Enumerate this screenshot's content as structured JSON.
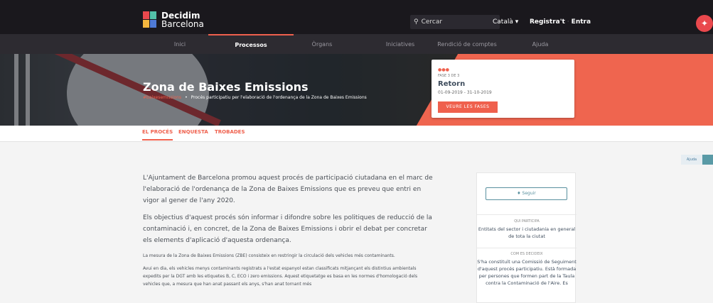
{
  "header": {
    "logo_line1": "Decidim",
    "logo_line2": "Barcelona",
    "search_placeholder": "Cercar",
    "language": "Català",
    "register": "Registra't",
    "login": "Entra"
  },
  "nav": [
    {
      "label": "Inici",
      "active": false
    },
    {
      "label": "Processos",
      "active": true
    },
    {
      "label": "Òrgans",
      "active": false
    },
    {
      "label": "Iniciatives",
      "active": false
    },
    {
      "label": "Rendició de comptes",
      "active": false
    },
    {
      "label": "Ajuda",
      "active": false
    }
  ],
  "hero": {
    "title": "Zona de Baixes Emissions",
    "hashtag": "#baixesemissions",
    "subtitle": "Procés participatiu per l'elaboració de l'ordenança de la Zona de Baixes Emissions"
  },
  "phase": {
    "dots": "●-●-●",
    "number": "FASE 3 DE 3",
    "name": "Retorn",
    "dates": "01-09-2019 - 31-10-2019",
    "button": "VEURE LES FASES"
  },
  "tabs": [
    {
      "label": "EL PROCÉS",
      "active": true
    },
    {
      "label": "ENQUESTA",
      "active": false
    },
    {
      "label": "TROBADES",
      "active": false
    }
  ],
  "help_label": "Ajuda",
  "content": {
    "p1": "L'Ajuntament de Barcelona promou aquest procés de participació ciutadana en el marc de l'elaboració de l'ordenança de la Zona de Baixes Emissions que es preveu que entri en vigor al gener de l'any 2020.",
    "p2": "Els objectius d'aquest procés són informar i difondre sobre les politiques de reducció de la contaminació i, en concret, de la Zona de Baixes Emissions i obrir el debat per concretar els elements d'aplicació d'aquesta ordenança.",
    "p3": "La mesura de la Zona de Baixes Emissions (ZBE) consisteix en restringir la circulació dels vehicles més contaminants.",
    "p4": "Avui en dia, els vehicles menys contaminants registrats a l'estat espanyol estan classificats mitjançant els distintius ambientals expedits per la DGT amb les etiquetes B, C, ECO i zero emissions. Aquest etiquetatge es basa en les normes d'homologació dels vehicles que, a mesura que han anat passant els anys, s'han anat tornant més"
  },
  "sidebar": {
    "follow": "Seguir",
    "who_heading": "QUI PARTICIPA",
    "who_text": "Entitats del sector i ciutadania en general de tota la ciutat",
    "how_heading": "COM ES DECIDEIX",
    "how_text": "S'ha constituït una Comissió de Seguiment d'aquest procés participatiu. Està formada per persones que formen part de la Taula contra la Contaminació de l'Aire. Es"
  },
  "colors": {
    "accent": "#ef604d",
    "topbar": "#1a181d",
    "navbar": "#2d2b31",
    "secondary": "#59909f"
  }
}
